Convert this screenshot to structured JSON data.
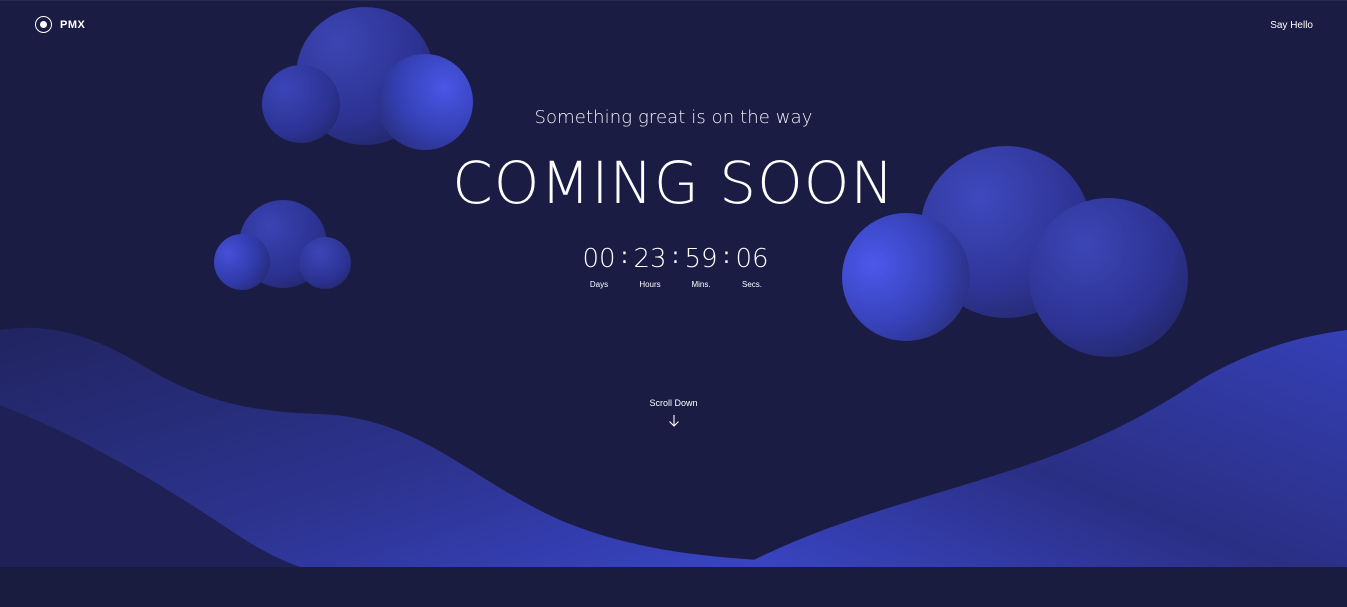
{
  "brand": {
    "name": "PMX",
    "icon": "circle-dot-icon"
  },
  "nav": {
    "say_hello": "Say Hello"
  },
  "hero": {
    "tagline": "Something great is on the way",
    "headline": "COMING SOON"
  },
  "countdown": {
    "separator": ":",
    "days": {
      "value": "00",
      "label": "Days"
    },
    "hours": {
      "value": "23",
      "label": "Hours"
    },
    "mins": {
      "value": "59",
      "label": "Mins."
    },
    "secs": {
      "value": "06",
      "label": "Secs."
    }
  },
  "scroll": {
    "label": "Scroll Down",
    "icon": "arrow-down-icon"
  },
  "colors": {
    "background": "#1a1c43",
    "accent": "#3f4ad2",
    "text": "#ffffff"
  }
}
